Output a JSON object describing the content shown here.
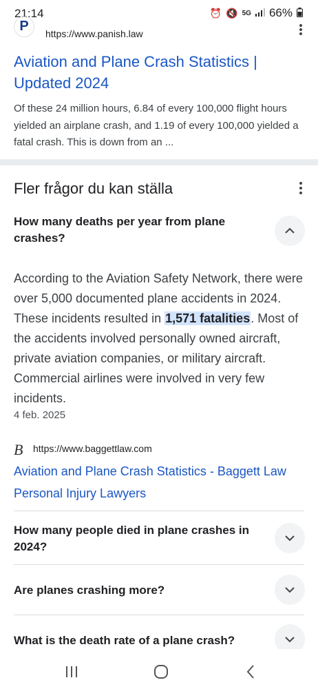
{
  "status_bar": {
    "time": "21:14",
    "battery": "66%",
    "network": "5G"
  },
  "top_result": {
    "favicon_letter": "P",
    "url": "https://www.panish.law",
    "title": "Aviation and Plane Crash Statistics | Updated 2024",
    "snippet": "Of these 24 million hours, 6.84 of every 100,000 flight hours yielded an airplane crash, and 1.19 of every 100,000 yielded a fatal crash. This is down from an ..."
  },
  "paa": {
    "heading": "Fler frågor du kan ställa",
    "expanded": {
      "question": "How many deaths per year from plane crashes?",
      "answer_before": "According to the Aviation Safety Network, there were over 5,000 documented plane accidents in 2024. These incidents resulted in ",
      "answer_highlight": "1,571 fatalities",
      "answer_after": ". Most of the accidents involved personally owned aircraft, private aviation companies, or military aircraft. Commercial airlines were involved in very few incidents.",
      "date": "4 feb. 2025",
      "source_icon": "B",
      "source_url": "https://www.baggettlaw.com",
      "source_title": "Aviation and Plane Crash Statistics - Baggett Law Personal Injury Lawyers"
    },
    "questions": [
      "How many people died in plane crashes in 2024?",
      "Are planes crashing more?",
      "What is the death rate of a plane crash?"
    ]
  },
  "icons": {
    "more": "more-vert-icon",
    "collapse": "chevron-up-icon",
    "expand": "chevron-down-icon",
    "nav_recent": "recent-apps-icon",
    "nav_home": "home-icon",
    "nav_back": "back-icon"
  },
  "colors": {
    "link": "#1a56c4",
    "highlight": "#d2e3fc",
    "divider": "#e9ecef"
  }
}
